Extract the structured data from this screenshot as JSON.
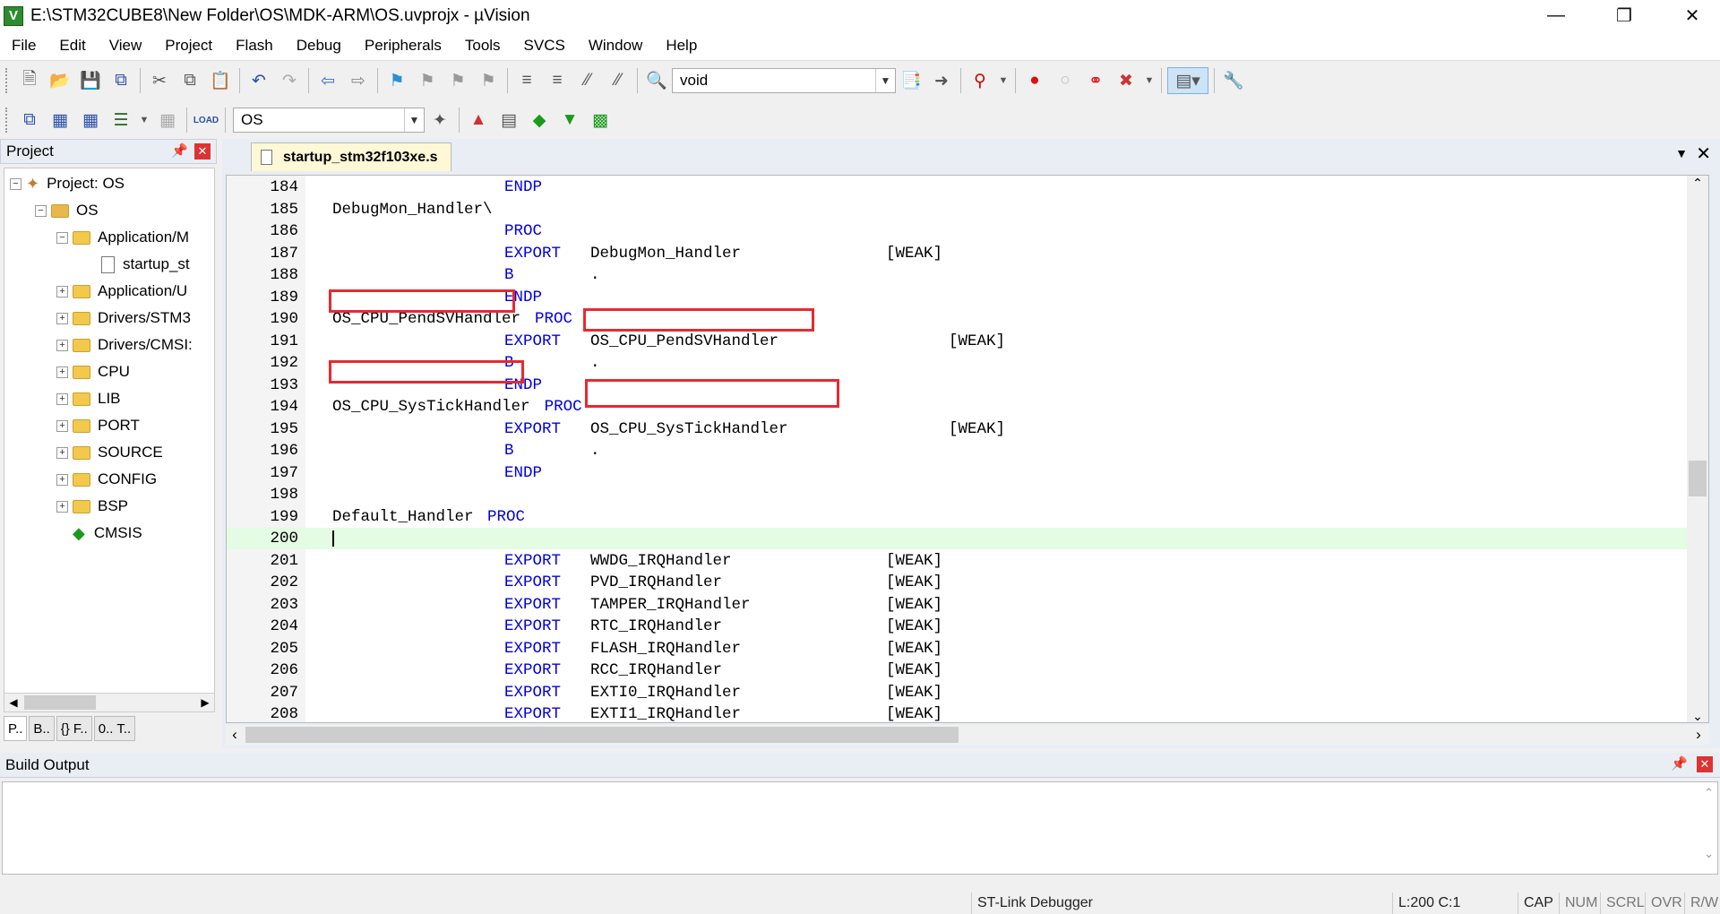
{
  "window": {
    "title": "E:\\STM32CUBE8\\New Folder\\OS\\MDK-ARM\\OS.uvprojx - µVision",
    "icon_letter": "V"
  },
  "menu": [
    "File",
    "Edit",
    "View",
    "Project",
    "Flash",
    "Debug",
    "Peripherals",
    "Tools",
    "SVCS",
    "Window",
    "Help"
  ],
  "toolbar": {
    "find_value": "void",
    "target_value": "OS"
  },
  "project": {
    "panel_title": "Project",
    "tree": [
      {
        "label": "Project: OS",
        "level": 0,
        "exp": "-",
        "kind": "root"
      },
      {
        "label": "OS",
        "level": 1,
        "exp": "-",
        "kind": "target"
      },
      {
        "label": "Application/M",
        "level": 2,
        "exp": "-",
        "kind": "folder"
      },
      {
        "label": "startup_st",
        "level": 3,
        "exp": "",
        "kind": "file"
      },
      {
        "label": "Application/U",
        "level": 2,
        "exp": "+",
        "kind": "folder"
      },
      {
        "label": "Drivers/STM3",
        "level": 2,
        "exp": "+",
        "kind": "folder"
      },
      {
        "label": "Drivers/CMSI:",
        "level": 2,
        "exp": "+",
        "kind": "folder"
      },
      {
        "label": "CPU",
        "level": 2,
        "exp": "+",
        "kind": "folder"
      },
      {
        "label": "LIB",
        "level": 2,
        "exp": "+",
        "kind": "folder"
      },
      {
        "label": "PORT",
        "level": 2,
        "exp": "+",
        "kind": "folder"
      },
      {
        "label": "SOURCE",
        "level": 2,
        "exp": "+",
        "kind": "folder"
      },
      {
        "label": "CONFIG",
        "level": 2,
        "exp": "+",
        "kind": "folder"
      },
      {
        "label": "BSP",
        "level": 2,
        "exp": "+",
        "kind": "folder"
      },
      {
        "label": "CMSIS",
        "level": 2,
        "exp": "",
        "kind": "gem"
      }
    ],
    "tabs": [
      "P..",
      "B..",
      "{} F..",
      "0.. T.."
    ]
  },
  "editor": {
    "tab_label": "startup_stm32f103xe.s",
    "lines": [
      {
        "n": "184",
        "label": "",
        "kw": "ENDP",
        "arg": "",
        "attr": ""
      },
      {
        "n": "185",
        "label": "DebugMon_Handler\\",
        "kw": "",
        "arg": "",
        "attr": ""
      },
      {
        "n": "186",
        "label": "",
        "kw": "PROC",
        "arg": "",
        "attr": ""
      },
      {
        "n": "187",
        "label": "",
        "kw": "EXPORT",
        "arg": "DebugMon_Handler",
        "attr": "[WEAK]"
      },
      {
        "n": "188",
        "label": "",
        "kw": "B",
        "arg": ".",
        "attr": ""
      },
      {
        "n": "189",
        "label": "",
        "kw": "ENDP",
        "arg": "",
        "attr": ""
      },
      {
        "n": "190",
        "label": "OS_CPU_PendSVHandler",
        "kw": "PROC",
        "arg": "",
        "attr": ""
      },
      {
        "n": "191",
        "label": "",
        "kw": "EXPORT",
        "arg": "OS_CPU_PendSVHandler",
        "attr": "[WEAK]"
      },
      {
        "n": "192",
        "label": "",
        "kw": "B",
        "arg": ".",
        "attr": ""
      },
      {
        "n": "193",
        "label": "",
        "kw": "ENDP",
        "arg": "",
        "attr": ""
      },
      {
        "n": "194",
        "label": "OS_CPU_SysTickHandler",
        "kw": "PROC",
        "arg": "",
        "attr": ""
      },
      {
        "n": "195",
        "label": "",
        "kw": "EXPORT",
        "arg": "OS_CPU_SysTickHandler",
        "attr": "[WEAK]"
      },
      {
        "n": "196",
        "label": "",
        "kw": "B",
        "arg": ".",
        "attr": ""
      },
      {
        "n": "197",
        "label": "",
        "kw": "ENDP",
        "arg": "",
        "attr": ""
      },
      {
        "n": "198",
        "label": "",
        "kw": "",
        "arg": "",
        "attr": ""
      },
      {
        "n": "199",
        "label": "Default_Handler",
        "kw": "PROC",
        "arg": "",
        "attr": ""
      },
      {
        "n": "200",
        "label": "",
        "kw": "",
        "arg": "",
        "attr": ""
      },
      {
        "n": "201",
        "label": "",
        "kw": "EXPORT",
        "arg": "WWDG_IRQHandler",
        "attr": "[WEAK]"
      },
      {
        "n": "202",
        "label": "",
        "kw": "EXPORT",
        "arg": "PVD_IRQHandler",
        "attr": "[WEAK]"
      },
      {
        "n": "203",
        "label": "",
        "kw": "EXPORT",
        "arg": "TAMPER_IRQHandler",
        "attr": "[WEAK]"
      },
      {
        "n": "204",
        "label": "",
        "kw": "EXPORT",
        "arg": "RTC_IRQHandler",
        "attr": "[WEAK]"
      },
      {
        "n": "205",
        "label": "",
        "kw": "EXPORT",
        "arg": "FLASH_IRQHandler",
        "attr": "[WEAK]"
      },
      {
        "n": "206",
        "label": "",
        "kw": "EXPORT",
        "arg": "RCC_IRQHandler",
        "attr": "[WEAK]"
      },
      {
        "n": "207",
        "label": "",
        "kw": "EXPORT",
        "arg": "EXTI0_IRQHandler",
        "attr": "[WEAK]"
      },
      {
        "n": "208",
        "label": "",
        "kw": "EXPORT",
        "arg": "EXTI1_IRQHandler",
        "attr": "[WEAK]"
      }
    ]
  },
  "build": {
    "title": "Build Output"
  },
  "status": {
    "debugger": "ST-Link Debugger",
    "position": "L:200 C:1",
    "cap": "CAP",
    "num": "NUM",
    "scrl": "SCRL",
    "ovr": "OVR",
    "rw": "R/W"
  }
}
